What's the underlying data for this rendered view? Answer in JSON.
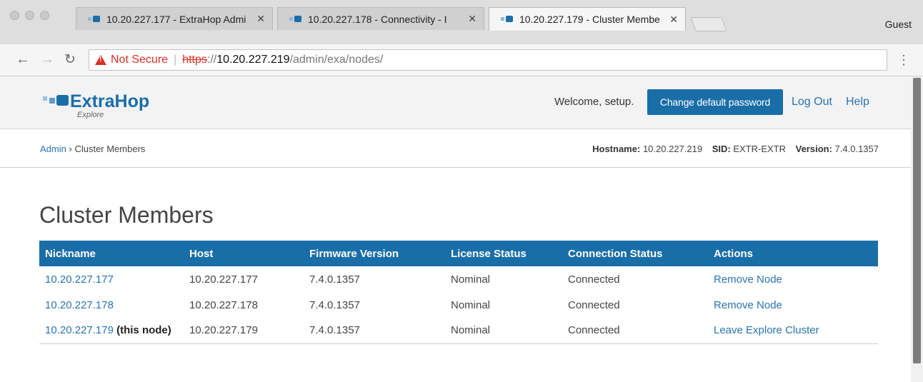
{
  "browser": {
    "tabs": [
      {
        "title": "10.20.227.177 - ExtraHop Admi"
      },
      {
        "title": "10.20.227.178 - Connectivity - I"
      },
      {
        "title": "10.20.227.179 - Cluster Membe"
      }
    ],
    "profile": "Guest",
    "address": {
      "security_label": "Not Secure",
      "scheme": "https",
      "host_prefix": "://",
      "host": "10.20.227.219",
      "path": "/admin/exa/nodes/"
    }
  },
  "header": {
    "brand": "ExtraHop",
    "brand_sub": "Explore",
    "welcome": "Welcome, setup.",
    "change_password": "Change default password",
    "logout": "Log Out",
    "help": "Help"
  },
  "breadcrumb": {
    "admin": "Admin",
    "separator": "›",
    "current": "Cluster Members"
  },
  "meta": {
    "hostname_label": "Hostname:",
    "hostname": "10.20.227.219",
    "sid_label": "SID:",
    "sid": "EXTR-EXTR",
    "version_label": "Version:",
    "version": "7.4.0.1357"
  },
  "page_title": "Cluster Members",
  "table": {
    "headers": [
      "Nickname",
      "Host",
      "Firmware Version",
      "License Status",
      "Connection Status",
      "Actions"
    ],
    "rows": [
      {
        "nickname": "10.20.227.177",
        "note": "",
        "host": "10.20.227.177",
        "firmware": "7.4.0.1357",
        "license": "Nominal",
        "connection": "Connected",
        "action": "Remove Node"
      },
      {
        "nickname": "10.20.227.178",
        "note": "",
        "host": "10.20.227.178",
        "firmware": "7.4.0.1357",
        "license": "Nominal",
        "connection": "Connected",
        "action": "Remove Node"
      },
      {
        "nickname": "10.20.227.179",
        "note": "(this node)",
        "host": "10.20.227.179",
        "firmware": "7.4.0.1357",
        "license": "Nominal",
        "connection": "Connected",
        "action": "Leave Explore Cluster"
      }
    ]
  },
  "colors": {
    "brand_blue": "#1a6ea8",
    "link_blue": "#2a74b0",
    "warning_red": "#d93025"
  }
}
